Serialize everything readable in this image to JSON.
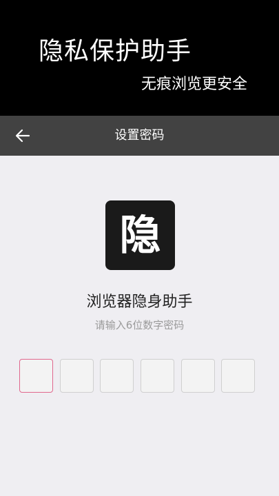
{
  "promo": {
    "title": "隐私保护助手",
    "subtitle": "无痕浏览更安全"
  },
  "toolbar": {
    "back_icon": "arrow-left-icon",
    "title": "设置密码"
  },
  "app": {
    "logo_char": "隐",
    "name": "浏览器隐身助手"
  },
  "password": {
    "hint": "请输入6位数字密码",
    "digits": [
      "",
      "",
      "",
      "",
      "",
      ""
    ],
    "active_index": 0
  },
  "colors": {
    "promo_bg": "#000000",
    "toolbar_bg": "#424242",
    "page_bg": "#efeef2",
    "active_border": "#e0668d"
  }
}
